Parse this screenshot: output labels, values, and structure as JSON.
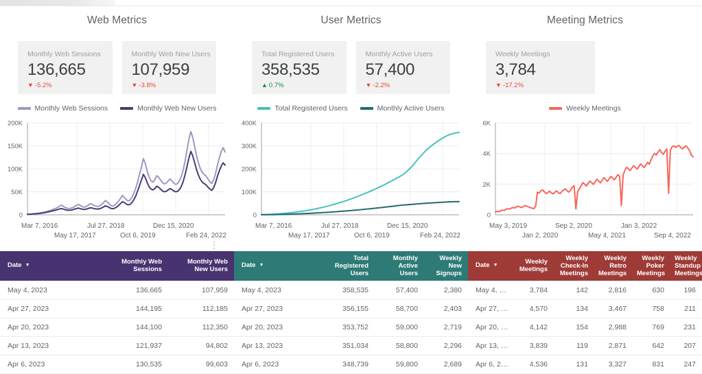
{
  "panels": [
    {
      "title": "Web Metrics",
      "accent": "#473370",
      "cards": [
        {
          "label": "Monthly Web Sessions",
          "value": "136,665",
          "delta": "-5.2%",
          "direction": "down",
          "arrow": "▼"
        },
        {
          "label": "Monthly Web New Users",
          "value": "107,959",
          "delta": "-3.8%",
          "direction": "down",
          "arrow": "▼"
        }
      ],
      "legend": [
        {
          "label": "Monthly Web Sessions",
          "color": "#a395c4"
        },
        {
          "label": "Monthly Web New Users",
          "color": "#4a3b72"
        }
      ],
      "xlabels_top": [
        "Mar 7, 2016",
        "Jul 27, 2018",
        "Dec 15, 2020"
      ],
      "xlabels_bottom": [
        "May 17, 2017",
        "Oct 6, 2019",
        "Feb 24, 2022"
      ],
      "table": {
        "headers": [
          "Date",
          "Monthly Web Sessions",
          "Monthly Web New Users"
        ],
        "sort_column": "Date",
        "sort_caret": "▼",
        "rows": [
          [
            "May 4, 2023",
            "136,665",
            "107,959"
          ],
          [
            "Apr 27, 2023",
            "144,195",
            "112,185"
          ],
          [
            "Apr 20, 2023",
            "144,100",
            "112,350"
          ],
          [
            "Apr 13, 2023",
            "121,937",
            "94,802"
          ],
          [
            "Apr 6, 2023",
            "130,535",
            "99,603"
          ]
        ]
      }
    },
    {
      "title": "User Metrics",
      "accent": "#2d7a76",
      "cards": [
        {
          "label": "Total Registered Users",
          "value": "358,535",
          "delta": "0.7%",
          "direction": "up",
          "arrow": "▲"
        },
        {
          "label": "Monthly Active Users",
          "value": "57,400",
          "delta": "-2.2%",
          "direction": "down",
          "arrow": "▼"
        }
      ],
      "legend": [
        {
          "label": "Total Registered Users",
          "color": "#45c1c0"
        },
        {
          "label": "Monthly Active Users",
          "color": "#236b6b"
        }
      ],
      "xlabels_top": [
        "Mar 7, 2016",
        "Jul 27, 2018",
        "Dec 15, 2020"
      ],
      "xlabels_bottom": [
        "May 17, 2017",
        "Oct 6, 2019",
        "Feb 24, 2022"
      ],
      "table": {
        "headers": [
          "Date",
          "Total Registered Users",
          "Monthly Active Users",
          "Weekly New Signups"
        ],
        "sort_column": "Date",
        "sort_caret": "▼",
        "rows": [
          [
            "May 4, 2023",
            "358,535",
            "57,400",
            "2,380"
          ],
          [
            "Apr 27, 2023",
            "356,155",
            "58,700",
            "2,403"
          ],
          [
            "Apr 20, 2023",
            "353,752",
            "59,000",
            "2,719"
          ],
          [
            "Apr 13, 2023",
            "351,034",
            "58,800",
            "2,296"
          ],
          [
            "Apr 6, 2023",
            "348,739",
            "59,800",
            "2,689"
          ]
        ]
      }
    },
    {
      "title": "Meeting Metrics",
      "accent": "#9e3b37",
      "cards": [
        {
          "label": "Weekly Meetings",
          "value": "3,784",
          "delta": "-17.2%",
          "direction": "down",
          "arrow": "▼"
        }
      ],
      "legend": [
        {
          "label": "Weekly Meetings",
          "color": "#f9655b"
        }
      ],
      "xlabels_top": [
        "May 3, 2019",
        "Sep 2, 2020",
        "Jan 3, 2022"
      ],
      "xlabels_bottom": [
        "Jan 2, 2020",
        "May 4, 2021",
        "Sep 4, 2022"
      ],
      "table": {
        "headers": [
          "Date",
          "Weekly Meetings",
          "Weekly Check-In Meetings",
          "Weekly Retro Meetings",
          "Weekly Poker Meetings",
          "Weekly Standup Meetings"
        ],
        "sort_column": "Date",
        "sort_caret": "▼",
        "rows": [
          [
            "May 4, …",
            "3,784",
            "142",
            "2,816",
            "630",
            "196"
          ],
          [
            "Apr 27, …",
            "4,570",
            "134",
            "3,467",
            "758",
            "211"
          ],
          [
            "Apr 20, …",
            "4,142",
            "154",
            "2,988",
            "769",
            "231"
          ],
          [
            "Apr 13, …",
            "3,839",
            "119",
            "2,871",
            "642",
            "207"
          ],
          [
            "Apr 6, 2…",
            "4,536",
            "131",
            "3,327",
            "831",
            "247"
          ]
        ]
      }
    }
  ],
  "chart_data": [
    {
      "type": "line",
      "title": "Web Metrics",
      "xlabel": "",
      "ylabel": "",
      "ylim": [
        0,
        200000
      ],
      "yticks": [
        "0",
        "50K",
        "100K",
        "150K",
        "200K"
      ],
      "xticks": [
        "Mar 7, 2016",
        "May 17, 2017",
        "Jul 27, 2018",
        "Oct 6, 2019",
        "Dec 15, 2020",
        "Feb 24, 2022"
      ],
      "grid": true,
      "legend_position": "top",
      "series": [
        {
          "name": "Monthly Web Sessions",
          "color": "#a395c4",
          "values": [
            1200,
            1500,
            1800,
            2200,
            2600,
            3000,
            3600,
            4200,
            5000,
            6000,
            7000,
            8200,
            9500,
            11000,
            12500,
            14000,
            16500,
            19000,
            21000,
            18000,
            15500,
            14000,
            13500,
            14500,
            16000,
            18500,
            21000,
            22500,
            20000,
            17500,
            16500,
            18000,
            21000,
            24000,
            23000,
            20500,
            19000,
            18000,
            19500,
            22000,
            26000,
            31000,
            28000,
            23500,
            20000,
            19000,
            21000,
            25000,
            30000,
            36000,
            42000,
            38000,
            33000,
            30000,
            32000,
            38000,
            47000,
            58000,
            72000,
            88000,
            104000,
            122000,
            112000,
            95000,
            82000,
            74000,
            71000,
            76000,
            85000,
            82000,
            76000,
            70000,
            67000,
            69000,
            73000,
            78000,
            74000,
            69000,
            66000,
            68000,
            74000,
            84000,
            98000,
            118000,
            142000,
            165000,
            181000,
            168000,
            148000,
            128000,
            112000,
            100000,
            92000,
            88000,
            84000,
            78000,
            72000,
            68000,
            76000,
            90000,
            108000,
            124000,
            138000,
            146000,
            136665
          ]
        },
        {
          "name": "Monthly Web New Users",
          "color": "#4a3b72",
          "values": [
            900,
            1100,
            1400,
            1700,
            2000,
            2400,
            2800,
            3300,
            3900,
            4600,
            5400,
            6300,
            7300,
            8300,
            9300,
            10200,
            11500,
            12800,
            13500,
            12200,
            10800,
            10000,
            9700,
            10300,
            11200,
            12600,
            13800,
            14500,
            13200,
            12000,
            11500,
            12300,
            13800,
            15200,
            14800,
            13500,
            12800,
            12300,
            13200,
            14800,
            17000,
            19500,
            18200,
            15800,
            13800,
            13200,
            14500,
            17000,
            20500,
            24500,
            28500,
            26500,
            23500,
            21500,
            22800,
            26500,
            33000,
            41000,
            52000,
            64000,
            76000,
            88000,
            81000,
            70000,
            61000,
            56000,
            54000,
            57000,
            62000,
            60000,
            56000,
            52000,
            50000,
            51000,
            54000,
            57000,
            55000,
            52000,
            50000,
            51000,
            55000,
            62000,
            73000,
            88000,
            106000,
            124000,
            138000,
            128000,
            113000,
            98000,
            86000,
            77000,
            71000,
            68000,
            65000,
            60000,
            56000,
            53000,
            59000,
            70000,
            84000,
            96000,
            106000,
            113000,
            107959
          ]
        }
      ]
    },
    {
      "type": "line",
      "title": "User Metrics",
      "xlabel": "",
      "ylabel": "",
      "ylim": [
        0,
        400000
      ],
      "yticks": [
        "0",
        "100K",
        "200K",
        "300K",
        "400K"
      ],
      "xticks": [
        "Mar 7, 2016",
        "May 17, 2017",
        "Jul 27, 2018",
        "Oct 6, 2019",
        "Dec 15, 2020",
        "Feb 24, 2022"
      ],
      "grid": true,
      "legend_position": "top",
      "series": [
        {
          "name": "Total Registered Users",
          "color": "#45c1c0",
          "values": [
            500,
            800,
            1200,
            1600,
            2100,
            2700,
            3300,
            4000,
            4800,
            5600,
            6500,
            7500,
            8500,
            9600,
            10800,
            12000,
            13300,
            14700,
            16200,
            17800,
            19500,
            21300,
            23200,
            25200,
            27300,
            29500,
            31800,
            34200,
            36700,
            39300,
            42000,
            44800,
            47700,
            50700,
            53800,
            57000,
            60300,
            63700,
            67200,
            70800,
            74500,
            78300,
            82200,
            86200,
            90300,
            94500,
            98800,
            103200,
            107700,
            112300,
            117000,
            121800,
            126700,
            131700,
            136800,
            142000,
            147300,
            152700,
            158200,
            163800,
            169500,
            176000,
            184000,
            193000,
            203000,
            214000,
            226000,
            238000,
            250000,
            261000,
            272000,
            282000,
            291000,
            299000,
            307000,
            314000,
            321000,
            328000,
            334000,
            340000,
            345000,
            349000,
            352000,
            355000,
            357000,
            358535
          ]
        },
        {
          "name": "Monthly Active Users",
          "color": "#236b6b",
          "values": [
            200,
            300,
            420,
            560,
            720,
            900,
            1100,
            1320,
            1560,
            1820,
            2100,
            2400,
            2720,
            3060,
            3420,
            3800,
            4200,
            4620,
            5060,
            5520,
            6000,
            6500,
            7020,
            7560,
            8120,
            8700,
            9300,
            9920,
            10560,
            11220,
            11900,
            12600,
            13320,
            14060,
            14820,
            15600,
            16400,
            17220,
            18060,
            18920,
            19800,
            20700,
            21620,
            22560,
            23520,
            24500,
            25500,
            26520,
            27560,
            28620,
            29700,
            30800,
            31920,
            33060,
            34220,
            35400,
            36600,
            37820,
            39060,
            40320,
            41600,
            42500,
            43200,
            44000,
            44800,
            45600,
            46400,
            47200,
            48000,
            48800,
            49600,
            50400,
            51000,
            51600,
            52200,
            52800,
            53400,
            54000,
            54600,
            55200,
            55800,
            56200,
            56600,
            57000,
            57200,
            57400
          ]
        }
      ]
    },
    {
      "type": "line",
      "title": "Meeting Metrics",
      "xlabel": "",
      "ylabel": "",
      "ylim": [
        0,
        6000
      ],
      "yticks": [
        "0",
        "2K",
        "4K",
        "6K"
      ],
      "xticks": [
        "May 3, 2019",
        "Jan 2, 2020",
        "Sep 2, 2020",
        "May 4, 2021",
        "Jan 3, 2022",
        "Sep 4, 2022"
      ],
      "grid": true,
      "legend_position": "top",
      "series": [
        {
          "name": "Weekly Meetings",
          "color": "#f9655b",
          "values": [
            180,
            230,
            200,
            260,
            310,
            280,
            350,
            400,
            370,
            430,
            480,
            440,
            520,
            560,
            510,
            470,
            540,
            600,
            560,
            510,
            470,
            430,
            400,
            560,
            1480,
            1420,
            1560,
            1620,
            1500,
            1380,
            1460,
            1540,
            1420,
            1360,
            1480,
            1560,
            1440,
            1380,
            1520,
            1620,
            1700,
            1560,
            1480,
            1620,
            1800,
            1900,
            380,
            1500,
            1700,
            1900,
            2100,
            2000,
            1880,
            2050,
            2200,
            2100,
            1980,
            2150,
            2320,
            2200,
            2080,
            2250,
            2420,
            2300,
            2180,
            2350,
            2500,
            2400,
            2280,
            2450,
            2620,
            2500,
            600,
            2600,
            2900,
            3100,
            3000,
            2880,
            3050,
            3200,
            3100,
            2980,
            3150,
            3320,
            3200,
            3080,
            3250,
            3420,
            3300,
            3600,
            3850,
            4000,
            3900,
            4100,
            4250,
            4050,
            3950,
            4150,
            4300,
            1400,
            4200,
            4450,
            4500,
            4400,
            4480,
            4520,
            4380,
            4300,
            4420,
            4500,
            4350,
            4200,
            3900,
            3784
          ]
        }
      ]
    }
  ]
}
